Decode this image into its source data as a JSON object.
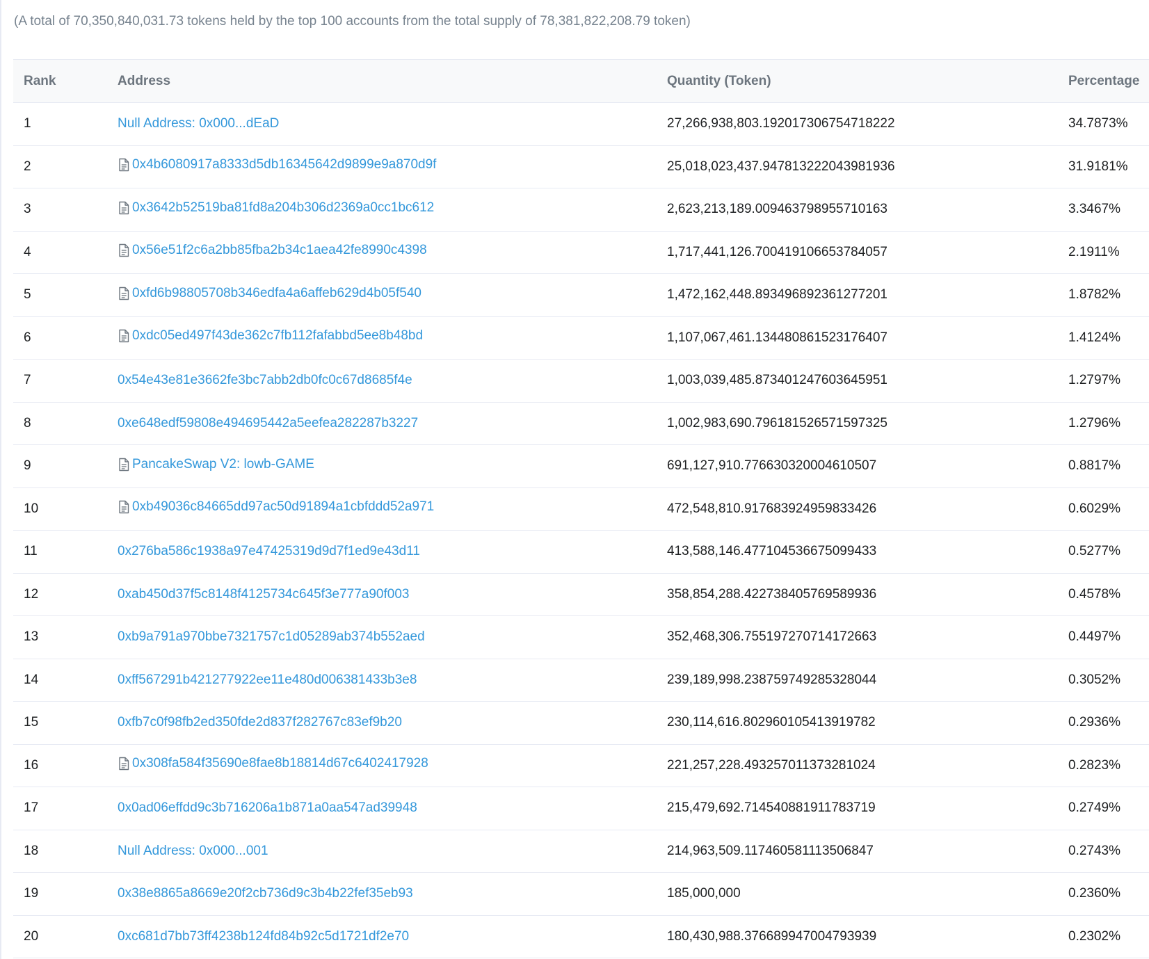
{
  "summary_text": "(A total of 70,350,840,031.73 tokens held by the top 100 accounts from the total supply of 78,381,822,208.79 token)",
  "table": {
    "headers": {
      "rank": "Rank",
      "address": "Address",
      "quantity": "Quantity (Token)",
      "percentage": "Percentage"
    },
    "rows": [
      {
        "rank": "1",
        "address": "Null Address: 0x000...dEaD",
        "is_contract": false,
        "quantity": "27,266,938,803.192017306754718222",
        "percentage": "34.7873%"
      },
      {
        "rank": "2",
        "address": "0x4b6080917a8333d5db16345642d9899e9a870d9f",
        "is_contract": true,
        "quantity": "25,018,023,437.947813222043981936",
        "percentage": "31.9181%"
      },
      {
        "rank": "3",
        "address": "0x3642b52519ba81fd8a204b306d2369a0cc1bc612",
        "is_contract": true,
        "quantity": "2,623,213,189.009463798955710163",
        "percentage": "3.3467%"
      },
      {
        "rank": "4",
        "address": "0x56e51f2c6a2bb85fba2b34c1aea42fe8990c4398",
        "is_contract": true,
        "quantity": "1,717,441,126.700419106653784057",
        "percentage": "2.1911%"
      },
      {
        "rank": "5",
        "address": "0xfd6b98805708b346edfa4a6affeb629d4b05f540",
        "is_contract": true,
        "quantity": "1,472,162,448.893496892361277201",
        "percentage": "1.8782%"
      },
      {
        "rank": "6",
        "address": "0xdc05ed497f43de362c7fb112fafabbd5ee8b48bd",
        "is_contract": true,
        "quantity": "1,107,067,461.134480861523176407",
        "percentage": "1.4124%"
      },
      {
        "rank": "7",
        "address": "0x54e43e81e3662fe3bc7abb2db0fc0c67d8685f4e",
        "is_contract": false,
        "quantity": "1,003,039,485.873401247603645951",
        "percentage": "1.2797%"
      },
      {
        "rank": "8",
        "address": "0xe648edf59808e494695442a5eefea282287b3227",
        "is_contract": false,
        "quantity": "1,002,983,690.796181526571597325",
        "percentage": "1.2796%"
      },
      {
        "rank": "9",
        "address": "PancakeSwap V2: lowb-GAME",
        "is_contract": true,
        "quantity": "691,127,910.776630320004610507",
        "percentage": "0.8817%"
      },
      {
        "rank": "10",
        "address": "0xb49036c84665dd97ac50d91894a1cbfddd52a971",
        "is_contract": true,
        "quantity": "472,548,810.917683924959833426",
        "percentage": "0.6029%"
      },
      {
        "rank": "11",
        "address": "0x276ba586c1938a97e47425319d9d7f1ed9e43d11",
        "is_contract": false,
        "quantity": "413,588,146.477104536675099433",
        "percentage": "0.5277%"
      },
      {
        "rank": "12",
        "address": "0xab450d37f5c8148f4125734c645f3e777a90f003",
        "is_contract": false,
        "quantity": "358,854,288.422738405769589936",
        "percentage": "0.4578%"
      },
      {
        "rank": "13",
        "address": "0xb9a791a970bbe7321757c1d05289ab374b552aed",
        "is_contract": false,
        "quantity": "352,468,306.755197270714172663",
        "percentage": "0.4497%"
      },
      {
        "rank": "14",
        "address": "0xff567291b421277922ee11e480d006381433b3e8",
        "is_contract": false,
        "quantity": "239,189,998.238759749285328044",
        "percentage": "0.3052%"
      },
      {
        "rank": "15",
        "address": "0xfb7c0f98fb2ed350fde2d837f282767c83ef9b20",
        "is_contract": false,
        "quantity": "230,114,616.802960105413919782",
        "percentage": "0.2936%"
      },
      {
        "rank": "16",
        "address": "0x308fa584f35690e8fae8b18814d67c6402417928",
        "is_contract": true,
        "quantity": "221,257,228.493257011373281024",
        "percentage": "0.2823%"
      },
      {
        "rank": "17",
        "address": "0x0ad06effdd9c3b716206a1b871a0aa547ad39948",
        "is_contract": false,
        "quantity": "215,479,692.714540881911783719",
        "percentage": "0.2749%"
      },
      {
        "rank": "18",
        "address": "Null Address: 0x000...001",
        "is_contract": false,
        "quantity": "214,963,509.117460581113506847",
        "percentage": "0.2743%"
      },
      {
        "rank": "19",
        "address": "0x38e8865a8669e20f2cb736d9c3b4b22fef35eb93",
        "is_contract": false,
        "quantity": "185,000,000",
        "percentage": "0.2360%"
      },
      {
        "rank": "20",
        "address": "0xc681d7bb73ff4238b124fd84b92c5d1721df2e70",
        "is_contract": false,
        "quantity": "180,430,988.376689947004793939",
        "percentage": "0.2302%"
      }
    ]
  },
  "colors": {
    "link": "#3498db",
    "text": "#1e2022",
    "muted": "#77838f",
    "header_bg": "#f8f9fa",
    "border": "#e7eaf3"
  },
  "icons": {
    "contract": "file-text-icon"
  }
}
